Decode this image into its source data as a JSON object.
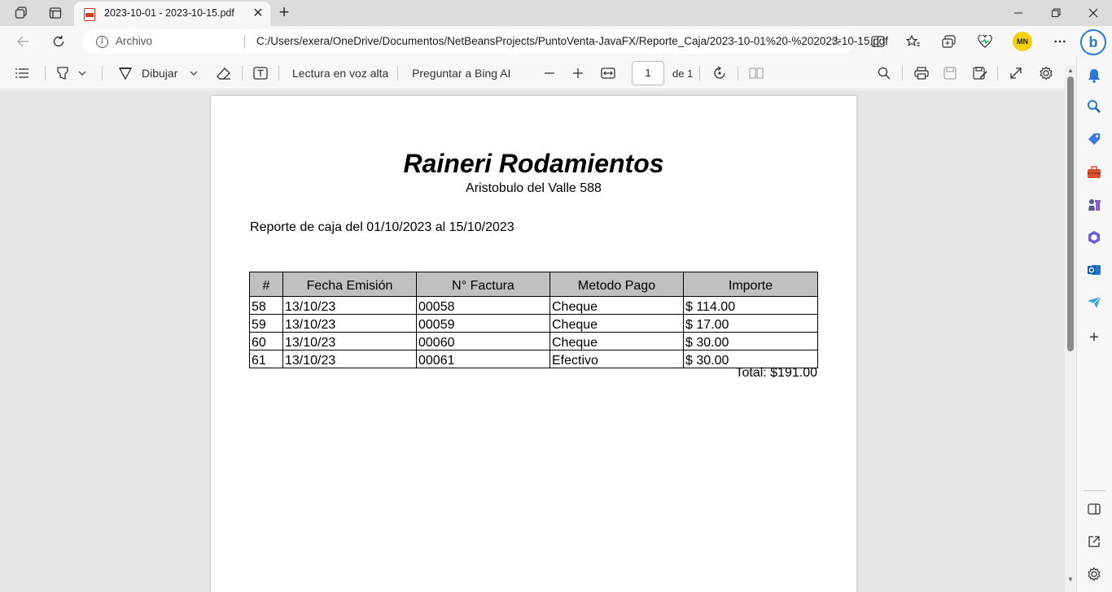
{
  "tab": {
    "title": "2023-10-01 - 2023-10-15.pdf",
    "close": "✕"
  },
  "newtab": "+",
  "address": {
    "site_info": "i",
    "archivo": "Archivo",
    "url": "C:/Users/exera/OneDrive/Documentos/NetBeansProjects/PuntoVenta-JavaFX/Reporte_Caja/2023-10-01%20-%202023-10-15.pdf",
    "star": "☆"
  },
  "profile_label": "MN",
  "pdf_toolbar": {
    "draw_label": "Dibujar",
    "read_aloud": "Lectura en voz alta",
    "ask_bing": "Preguntar a Bing AI",
    "page_number": "1",
    "page_total": "de 1"
  },
  "document": {
    "company": "Raineri Rodamientos",
    "address": "Aristobulo del Valle 588",
    "report_title": "Reporte de caja del 01/10/2023 al 15/10/2023",
    "columns": [
      "#",
      "Fecha Emisión",
      "N° Factura",
      "Metodo Pago",
      "Importe"
    ],
    "rows": [
      [
        "58",
        "13/10/23",
        "00058",
        "Cheque",
        "$ 114.00"
      ],
      [
        "59",
        "13/10/23",
        "00059",
        "Cheque",
        "$ 17.00"
      ],
      [
        "60",
        "13/10/23",
        "00060",
        "Cheque",
        "$ 30.00"
      ],
      [
        "61",
        "13/10/23",
        "00061",
        "Efectivo",
        "$ 30.00"
      ]
    ],
    "total": "Total: $191.00"
  },
  "colors": {
    "accent": "#2a78d6",
    "table_header": "#c0c0c0",
    "pdf_icon": "#d4371f",
    "profile": "#f5d10c"
  }
}
